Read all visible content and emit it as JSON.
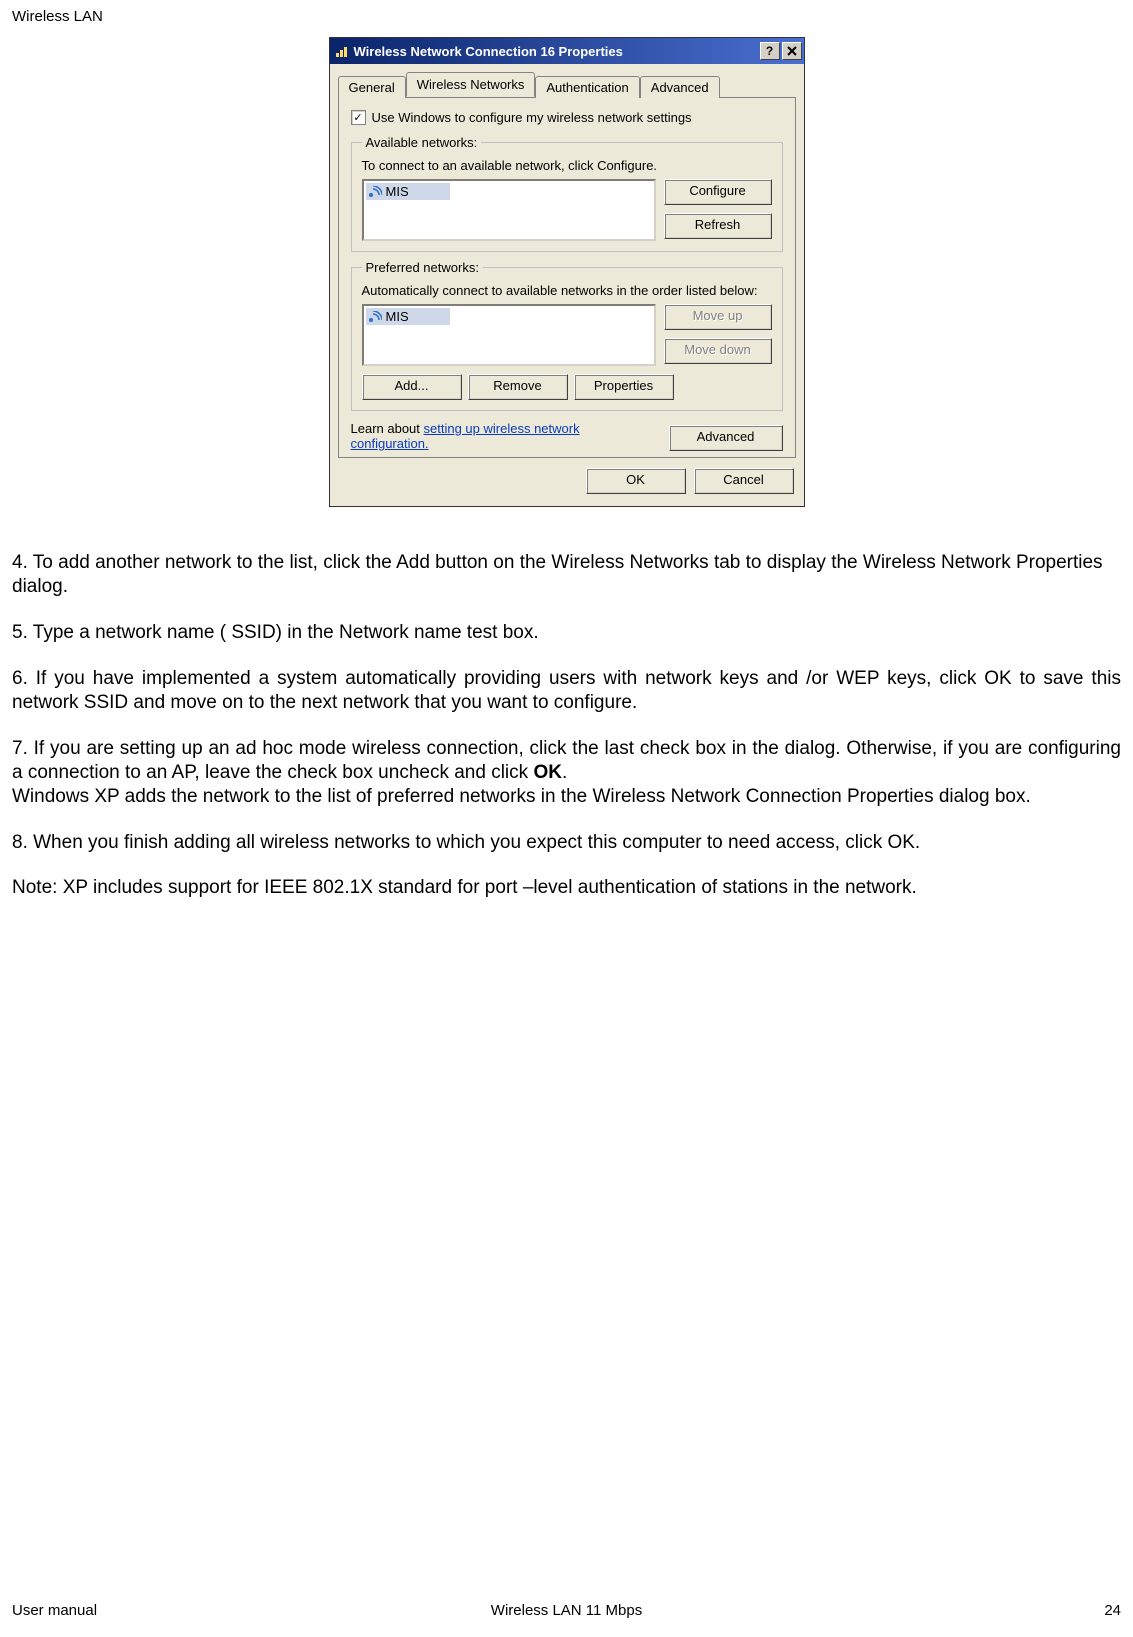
{
  "header": "Wireless LAN",
  "dialog": {
    "title": "Wireless Network Connection 16 Properties",
    "tabs": [
      "General",
      "Wireless Networks",
      "Authentication",
      "Advanced"
    ],
    "active_tab": 1,
    "checkbox_label": "Use Windows to configure my wireless network settings",
    "checkbox_checked": "✓",
    "available": {
      "legend": "Available networks:",
      "text": "To connect to an available network, click Configure.",
      "items": [
        "MIS"
      ],
      "buttons": [
        "Configure",
        "Refresh"
      ]
    },
    "preferred": {
      "legend": "Preferred networks:",
      "text": "Automatically connect to available networks in the order listed below:",
      "items": [
        "MIS"
      ],
      "side_buttons": [
        "Move up",
        "Move down"
      ],
      "row_buttons": [
        "Add...",
        "Remove",
        "Properties"
      ]
    },
    "learn_prefix": "Learn about ",
    "learn_link": "setting up wireless network configuration.",
    "advanced_button": "Advanced",
    "footer_buttons": [
      "OK",
      "Cancel"
    ]
  },
  "body": {
    "p1": "4. To add another network to the list, click the Add button on the Wireless Networks tab to display the Wireless Network Properties dialog.",
    "p2": "5. Type a network name ( SSID) in the Network name test box.",
    "p3": "6. If you have implemented a system automatically providing users with network keys and /or WEP keys, click OK to save this network SSID and move on to the next network that you want to configure.",
    "p4a": "7. If you are setting up an ad hoc mode wireless connection, click the last check box in the dialog. Otherwise, if you are configuring a connection to an AP, leave the check box uncheck and click ",
    "p4b": "OK",
    "p4c": ".",
    "p5": "Windows XP adds the network to the list of preferred networks in the Wireless Network  Connection Properties dialog box.",
    "p6": "8. When you finish adding all  wireless networks to which you expect this computer to need access, click OK.",
    "p7": "Note: XP includes support for IEEE 802.1X standard for port –level authentication of stations in the network."
  },
  "footer": {
    "left": "User manual",
    "center": "Wireless LAN 11 Mbps",
    "right": "24"
  }
}
